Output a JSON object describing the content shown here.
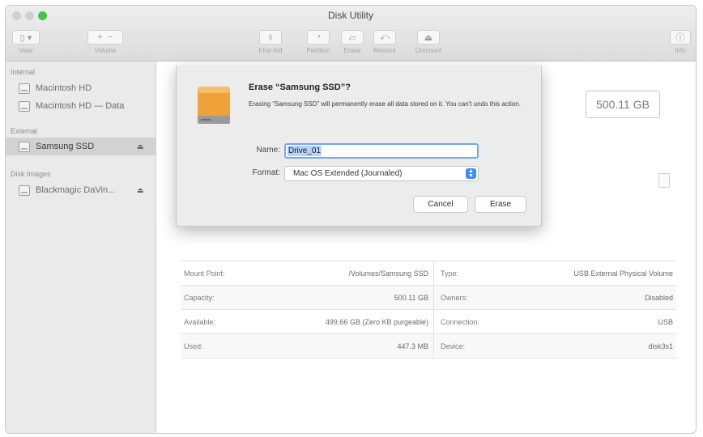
{
  "window": {
    "title": "Disk Utility"
  },
  "toolbar": {
    "view_label": "View",
    "volume_label": "Volume",
    "first_aid_label": "First Aid",
    "partition_label": "Partition",
    "erase_label": "Erase",
    "restore_label": "Restore",
    "unmount_label": "Unmount",
    "info_label": "Info"
  },
  "sidebar": {
    "sections": [
      {
        "label": "Internal"
      },
      {
        "label": "External"
      },
      {
        "label": "Disk Images"
      }
    ],
    "items": [
      {
        "label": "Macintosh HD",
        "section": "Internal"
      },
      {
        "label": "Macintosh HD — Data",
        "section": "Internal"
      },
      {
        "label": "Samsung SSD",
        "section": "External",
        "selected": true,
        "eject": "⏏"
      },
      {
        "label": "Blackmagic DaVin...",
        "section": "Disk Images",
        "eject": "⏏"
      }
    ]
  },
  "main": {
    "capacity_display": "500.11 GB",
    "info": [
      {
        "k1": "Mount Point:",
        "v1": "/Volumes/Samsung SSD",
        "k2": "Type:",
        "v2": "USB External Physical Volume"
      },
      {
        "k1": "Capacity:",
        "v1": "500.11 GB",
        "k2": "Owners:",
        "v2": "Disabled"
      },
      {
        "k1": "Available:",
        "v1": "499.66 GB (Zero KB purgeable)",
        "k2": "Connection:",
        "v2": "USB"
      },
      {
        "k1": "Used:",
        "v1": "447.3 MB",
        "k2": "Device:",
        "v2": "disk3s1"
      }
    ]
  },
  "dialog": {
    "title": "Erase “Samsung SSD”?",
    "message": "Erasing “Samsung SSD” will permanently erase all data stored on it. You can't undo this action.",
    "name_label": "Name:",
    "name_value": "Drive_01",
    "format_label": "Format:",
    "format_value": "Mac OS Extended (Journaled)",
    "cancel_label": "Cancel",
    "erase_label": "Erase"
  },
  "colors": {
    "drive_orange": "#f0a23a",
    "select_accent": "#3e8ef7"
  }
}
